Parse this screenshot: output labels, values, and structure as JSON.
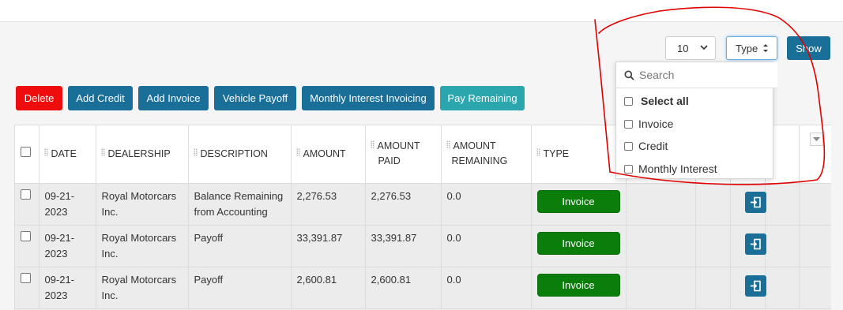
{
  "controls": {
    "page_size": "10",
    "type_filter": "Type",
    "show_label": "Show"
  },
  "toolbar": {
    "delete": "Delete",
    "add_credit": "Add Credit",
    "add_invoice": "Add Invoice",
    "vehicle_payoff": "Vehicle Payoff",
    "monthly_interest_invoicing": "Monthly Interest Invoicing",
    "pay_remaining": "Pay Remaining"
  },
  "type_dropdown": {
    "search_placeholder": "Search",
    "select_all": "Select all",
    "options": [
      "Invoice",
      "Credit",
      "Monthly Interest"
    ]
  },
  "table": {
    "columns": {
      "date": "DATE",
      "dealership": "DEALERSHIP",
      "description": "DESCRIPTION",
      "amount": "AMOUNT",
      "amount_paid_1": "AMOUNT",
      "amount_paid_2": "PAID",
      "amount_remaining_1": "AMOUNT",
      "amount_remaining_2": "REMAINING",
      "type": "TYPE"
    },
    "rows": [
      {
        "date_1": "09-21-",
        "date_2": "2023",
        "dealer_1": "Royal Motorcars",
        "dealer_2": "Inc.",
        "desc_1": "Balance Remaining",
        "desc_2": "from Accounting",
        "amount": "2,276.53",
        "paid": "2,276.53",
        "remaining": "0.0",
        "type": "Invoice"
      },
      {
        "date_1": "09-21-",
        "date_2": "2023",
        "dealer_1": "Royal Motorcars",
        "dealer_2": "Inc.",
        "desc_1": "Payoff",
        "desc_2": "",
        "amount": "33,391.87",
        "paid": "33,391.87",
        "remaining": "0.0",
        "type": "Invoice"
      },
      {
        "date_1": "09-21-",
        "date_2": "2023",
        "dealer_1": "Royal Motorcars",
        "dealer_2": "Inc.",
        "desc_1": "Payoff",
        "desc_2": "",
        "amount": "2,600.81",
        "paid": "2,600.81",
        "remaining": "0.0",
        "type": "Invoice"
      }
    ]
  },
  "colors": {
    "primary": "#1a6f99",
    "danger": "#ee0c0c",
    "teal": "#2ba6ad",
    "invoice_badge": "#0b7d0b",
    "annotation": "#e00000"
  },
  "icons": {
    "search": "search-icon",
    "row_action": "sign-in-icon",
    "column_menu": "caret-down-icon"
  }
}
